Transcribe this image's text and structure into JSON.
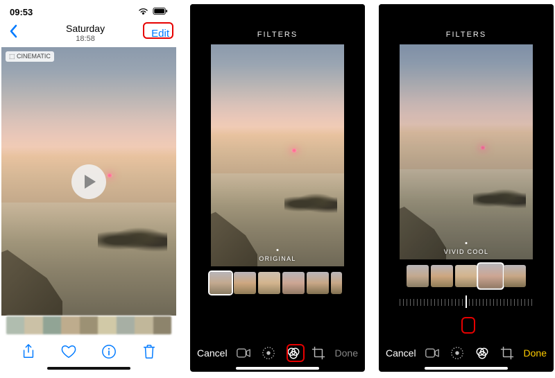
{
  "screen1": {
    "status_time": "09:53",
    "nav": {
      "date": "Saturday",
      "time": "18:58",
      "edit": "Edit"
    },
    "badge": "⬚ CINEMATIC"
  },
  "screen2": {
    "title": "FILTERS",
    "filter_name": "ORIGINAL",
    "cancel": "Cancel",
    "done": "Done"
  },
  "screen3": {
    "title": "FILTERS",
    "filter_name": "VIVID COOL",
    "cancel": "Cancel",
    "done": "Done"
  }
}
